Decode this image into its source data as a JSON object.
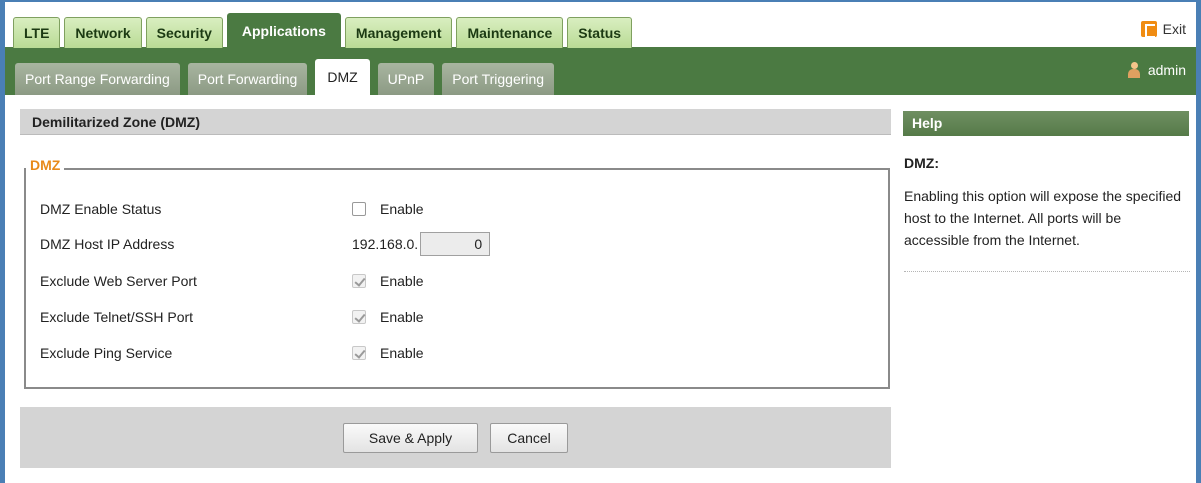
{
  "top_tabs": [
    {
      "label": "LTE",
      "active": false
    },
    {
      "label": "Network",
      "active": false
    },
    {
      "label": "Security",
      "active": false
    },
    {
      "label": "Applications",
      "active": true
    },
    {
      "label": "Management",
      "active": false
    },
    {
      "label": "Maintenance",
      "active": false
    },
    {
      "label": "Status",
      "active": false
    }
  ],
  "exit_label": "Exit",
  "sub_tabs": [
    {
      "label": "Port Range Forwarding",
      "active": false
    },
    {
      "label": "Port Forwarding",
      "active": false
    },
    {
      "label": "DMZ",
      "active": true
    },
    {
      "label": "UPnP",
      "active": false
    },
    {
      "label": "Port Triggering",
      "active": false
    }
  ],
  "user_label": "admin",
  "section_title": "Demilitarized Zone (DMZ)",
  "fieldset_legend": "DMZ",
  "rows": {
    "enable_status": {
      "label": "DMZ Enable Status",
      "control_label": "Enable",
      "checked": false
    },
    "host_ip": {
      "label": "DMZ Host IP Address",
      "prefix": "192.168.0.",
      "value": "0"
    },
    "exclude_web": {
      "label": "Exclude Web Server Port",
      "control_label": "Enable",
      "checked": true
    },
    "exclude_telnet": {
      "label": "Exclude Telnet/SSH Port",
      "control_label": "Enable",
      "checked": true
    },
    "exclude_ping": {
      "label": "Exclude Ping Service",
      "control_label": "Enable",
      "checked": true
    }
  },
  "buttons": {
    "save": "Save & Apply",
    "cancel": "Cancel"
  },
  "help": {
    "header": "Help",
    "title": "DMZ:",
    "text": "Enabling this option will expose the specified host to the Internet. All ports will be accessible from the Internet."
  },
  "colors": {
    "frame": "#4a7fb5",
    "nav_green": "#4b7a42",
    "tab_light_green": "#b9db95",
    "legend_orange": "#e88a1a",
    "panel_gray": "#d4d4d4"
  }
}
